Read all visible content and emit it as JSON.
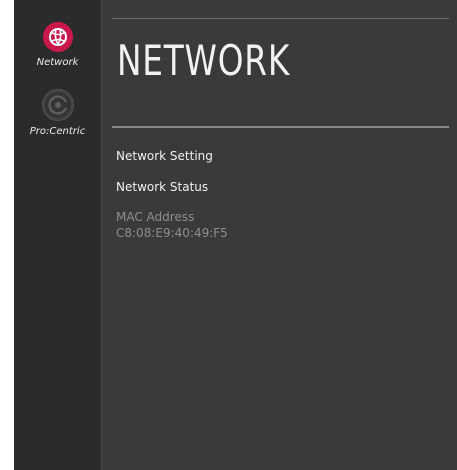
{
  "sidebar": {
    "items": [
      {
        "label": "Network",
        "icon": "globe-icon",
        "active": true
      },
      {
        "label": "Pro:Centric",
        "icon": "procentric-icon",
        "active": false
      }
    ]
  },
  "main": {
    "title": "NETWORK",
    "menu": [
      {
        "label": "Network Setting"
      },
      {
        "label": "Network Status"
      }
    ],
    "mac": {
      "label": "MAC Address",
      "value": "C8:08:E9:40:49:F5"
    }
  },
  "colors": {
    "accent": "#c8174b",
    "background": "#3a3a3a",
    "sidebar": "#2b2b2b",
    "muted_text": "#8e8e8e"
  }
}
